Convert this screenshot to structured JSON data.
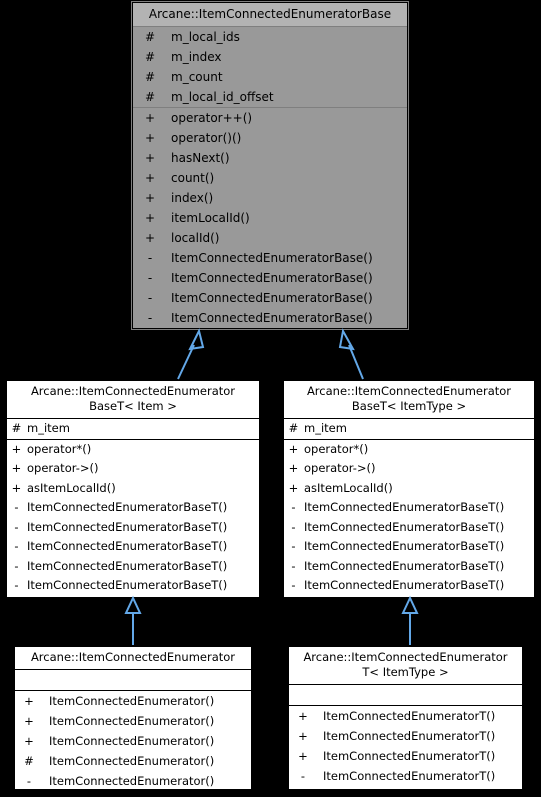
{
  "diagram": {
    "type": "uml-class-inheritance-diagram",
    "background_color": "#000000",
    "arrow_color": "#63a8e8",
    "shaded_fill": "#999999",
    "plain_fill": "#ffffff",
    "classes": [
      {
        "id": "base",
        "title": "Arcane::ItemConnectedEnumeratorBase",
        "attributes": [
          {
            "visibility": "#",
            "name": "m_local_ids"
          },
          {
            "visibility": "#",
            "name": "m_index"
          },
          {
            "visibility": "#",
            "name": "m_count"
          },
          {
            "visibility": "#",
            "name": "m_local_id_offset"
          }
        ],
        "methods": [
          {
            "visibility": "+",
            "name": "operator++()"
          },
          {
            "visibility": "+",
            "name": "operator()()"
          },
          {
            "visibility": "+",
            "name": "hasNext()"
          },
          {
            "visibility": "+",
            "name": "count()"
          },
          {
            "visibility": "+",
            "name": "index()"
          },
          {
            "visibility": "+",
            "name": "itemLocalId()"
          },
          {
            "visibility": "+",
            "name": "localId()"
          },
          {
            "visibility": "-",
            "name": "ItemConnectedEnumeratorBase()"
          },
          {
            "visibility": "-",
            "name": "ItemConnectedEnumeratorBase()"
          },
          {
            "visibility": "-",
            "name": "ItemConnectedEnumeratorBase()"
          },
          {
            "visibility": "-",
            "name": "ItemConnectedEnumeratorBase()"
          }
        ]
      },
      {
        "id": "baset_item",
        "title": "Arcane::ItemConnectedEnumerator\nBaseT< Item >",
        "attributes": [
          {
            "visibility": "#",
            "name": "m_item"
          }
        ],
        "methods": [
          {
            "visibility": "+",
            "name": "operator*()"
          },
          {
            "visibility": "+",
            "name": "operator->()"
          },
          {
            "visibility": "+",
            "name": "asItemLocalId()"
          },
          {
            "visibility": "-",
            "name": "ItemConnectedEnumeratorBaseT()"
          },
          {
            "visibility": "-",
            "name": "ItemConnectedEnumeratorBaseT()"
          },
          {
            "visibility": "-",
            "name": "ItemConnectedEnumeratorBaseT()"
          },
          {
            "visibility": "-",
            "name": "ItemConnectedEnumeratorBaseT()"
          },
          {
            "visibility": "-",
            "name": "ItemConnectedEnumeratorBaseT()"
          }
        ]
      },
      {
        "id": "baset_itemtype",
        "title": "Arcane::ItemConnectedEnumerator\nBaseT< ItemType >",
        "attributes": [
          {
            "visibility": "#",
            "name": "m_item"
          }
        ],
        "methods": [
          {
            "visibility": "+",
            "name": "operator*()"
          },
          {
            "visibility": "+",
            "name": "operator->()"
          },
          {
            "visibility": "+",
            "name": "asItemLocalId()"
          },
          {
            "visibility": "-",
            "name": "ItemConnectedEnumeratorBaseT()"
          },
          {
            "visibility": "-",
            "name": "ItemConnectedEnumeratorBaseT()"
          },
          {
            "visibility": "-",
            "name": "ItemConnectedEnumeratorBaseT()"
          },
          {
            "visibility": "-",
            "name": "ItemConnectedEnumeratorBaseT()"
          },
          {
            "visibility": "-",
            "name": "ItemConnectedEnumeratorBaseT()"
          }
        ]
      },
      {
        "id": "enumerator",
        "title": "Arcane::ItemConnectedEnumerator",
        "attributes": [],
        "methods": [
          {
            "visibility": "+",
            "name": "ItemConnectedEnumerator()"
          },
          {
            "visibility": "+",
            "name": "ItemConnectedEnumerator()"
          },
          {
            "visibility": "+",
            "name": "ItemConnectedEnumerator()"
          },
          {
            "visibility": "#",
            "name": "ItemConnectedEnumerator()"
          },
          {
            "visibility": "-",
            "name": "ItemConnectedEnumerator()"
          }
        ]
      },
      {
        "id": "enumeratort",
        "title": "Arcane::ItemConnectedEnumerator\nT< ItemType >",
        "attributes": [],
        "methods": [
          {
            "visibility": "+",
            "name": "ItemConnectedEnumeratorT()"
          },
          {
            "visibility": "+",
            "name": "ItemConnectedEnumeratorT()"
          },
          {
            "visibility": "+",
            "name": "ItemConnectedEnumeratorT()"
          },
          {
            "visibility": "-",
            "name": "ItemConnectedEnumeratorT()"
          }
        ]
      }
    ],
    "inheritance_edges": [
      {
        "from": "baset_item",
        "to": "base"
      },
      {
        "from": "baset_itemtype",
        "to": "base"
      },
      {
        "from": "enumerator",
        "to": "baset_item"
      },
      {
        "from": "enumeratort",
        "to": "baset_itemtype"
      }
    ]
  }
}
